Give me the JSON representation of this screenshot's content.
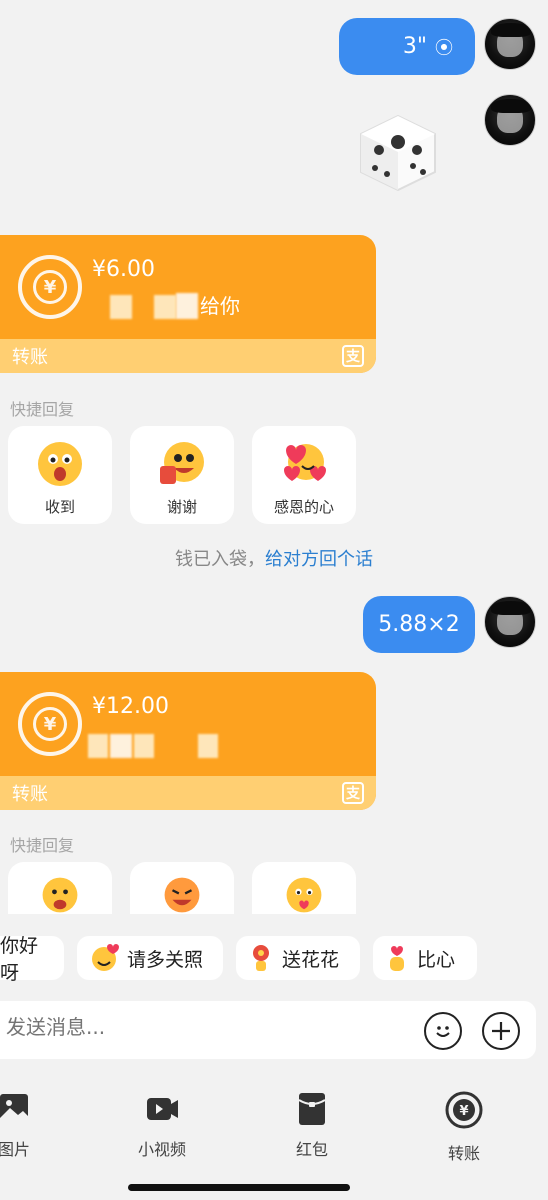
{
  "messages": {
    "voice": {
      "duration": "3\""
    },
    "card1": {
      "amount": "¥6.00",
      "desc_suffix": "给你",
      "label": "转账"
    },
    "quick_reply_label_1": "快捷回复",
    "quick_replies_1": [
      "收到",
      "谢谢",
      "感恩的心"
    ],
    "info": {
      "text": "钱已入袋，",
      "link": "给对方回个话"
    },
    "text_message": "5.88×2",
    "card2": {
      "amount": "¥12.00",
      "label": "转账"
    },
    "quick_reply_label_2": "快捷回复"
  },
  "suggestions": [
    "你好呀",
    "请多关照",
    "送花花",
    "比心"
  ],
  "input": {
    "placeholder": "发送消息..."
  },
  "toolbar": [
    "图片",
    "小视频",
    "红包",
    "转账"
  ],
  "colors": {
    "bubble_blue": "#3b8cf0",
    "transfer_orange": "#fda21f",
    "link_blue": "#2b7fd0"
  },
  "icons": [
    "voice-icon",
    "dice-icon",
    "yen-icon",
    "alipay-icon",
    "emoji-icon",
    "plus-icon",
    "image-icon",
    "video-icon",
    "red-packet-icon",
    "transfer-icon"
  ]
}
